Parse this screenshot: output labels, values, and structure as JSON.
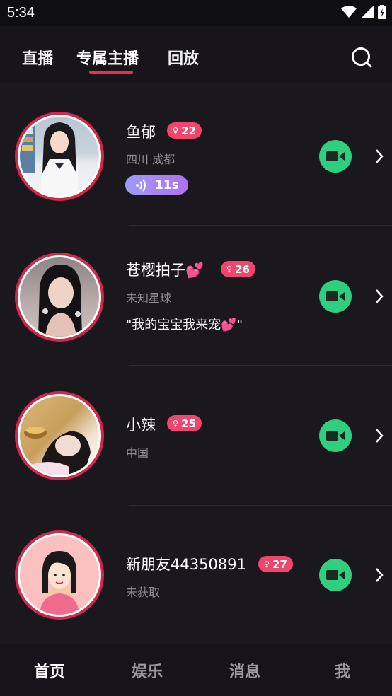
{
  "status_bar": {
    "time": "5:34"
  },
  "top_tabs": [
    {
      "label": "直播"
    },
    {
      "label": "专属主播"
    },
    {
      "label": "回放"
    }
  ],
  "active_tab": "专属主播",
  "colors": {
    "accent": "#ee2a56",
    "badge": "#f0456d",
    "video_button": "#2ecf7e",
    "avatar_ring": "#d1284d"
  },
  "anchors": [
    {
      "name": "鱼郁",
      "age": "22",
      "location": "四川 成都",
      "voice_duration": "11s"
    },
    {
      "name": "苍樱拍子💕",
      "age": "26",
      "location": "未知星球",
      "signature": "\"我的宝宝我来宠💕\""
    },
    {
      "name": "小辣",
      "age": "25",
      "location": "中国"
    },
    {
      "name": "新朋友44350891",
      "age": "27",
      "location": "未获取"
    }
  ],
  "bottom_nav": [
    {
      "label": "首页"
    },
    {
      "label": "娱乐"
    },
    {
      "label": "消息"
    },
    {
      "label": "我"
    }
  ],
  "active_bottom": "首页"
}
